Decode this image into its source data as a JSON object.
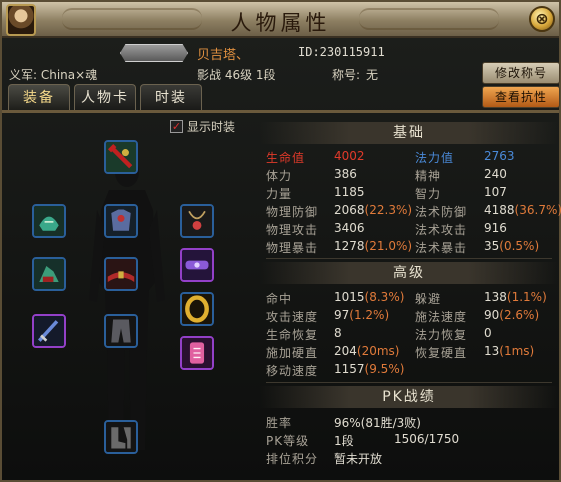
{
  "window": {
    "title": "人物属性",
    "close_label": "⊗"
  },
  "header": {
    "name": "贝吉塔、",
    "id": "ID:230115911",
    "guild": "义军: China×魂",
    "level": "影战 46级 1段",
    "title_label": "称号:",
    "title_value": "无"
  },
  "buttons": {
    "change_title": "修改称号",
    "view_resist": "查看抗性"
  },
  "tabs": [
    {
      "label": "装备",
      "active": true
    },
    {
      "label": "人物卡",
      "active": false
    },
    {
      "label": "时装",
      "active": false
    }
  ],
  "equipment": {
    "show_fashion_label": "显示时装",
    "show_fashion_checked": true
  },
  "basic": {
    "heading": "基础",
    "rows": [
      {
        "l1": "生命值",
        "v1": "4002",
        "l2": "法力值",
        "v2": "2763"
      },
      {
        "l1": "体力",
        "v1": "386",
        "l2": "精神",
        "v2": "240"
      },
      {
        "l1": "力量",
        "v1": "1185",
        "l2": "智力",
        "v2": "107"
      },
      {
        "l1": "物理防御",
        "v1": "2068",
        "p1": "(22.3%)",
        "l2": "法术防御",
        "v2": "4188",
        "p2": "(36.7%)"
      },
      {
        "l1": "物理攻击",
        "v1": "3406",
        "l2": "法术攻击",
        "v2": "916"
      },
      {
        "l1": "物理暴击",
        "v1": "1278",
        "p1": "(21.0%)",
        "l2": "法术暴击",
        "v2": "35",
        "p2": "(0.5%)"
      }
    ]
  },
  "advanced": {
    "heading": "高级",
    "rows": [
      {
        "l1": "命中",
        "v1": "1015",
        "p1": "(8.3%)",
        "l2": "躲避",
        "v2": "138",
        "p2": "(1.1%)"
      },
      {
        "l1": "攻击速度",
        "v1": "97",
        "p1": "(1.2%)",
        "l2": "施法速度",
        "v2": "90",
        "p2": "(2.6%)"
      },
      {
        "l1": "生命恢复",
        "v1": "8",
        "l2": "法力恢复",
        "v2": "0"
      },
      {
        "l1": "施加硬直",
        "v1": "204",
        "p1": "(20ms)",
        "l2": "恢复硬直",
        "v2": "13",
        "p2": "(1ms)"
      },
      {
        "l1": "移动速度",
        "v1": "1157",
        "p1": "(9.5%)"
      }
    ]
  },
  "pk": {
    "heading": "PK战绩",
    "win_rate_label": "胜率",
    "win_rate_value": "96%(81胜/3败)",
    "rank_label": "PK等级",
    "rank_value": "1段",
    "rank_points": "1506/1750",
    "position_label": "排位积分",
    "position_value": "暂未开放"
  },
  "colors": {
    "hp": "#e03a2a",
    "mp": "#4a8ad8",
    "percent": "#e07a3a",
    "name": "#e09040"
  }
}
